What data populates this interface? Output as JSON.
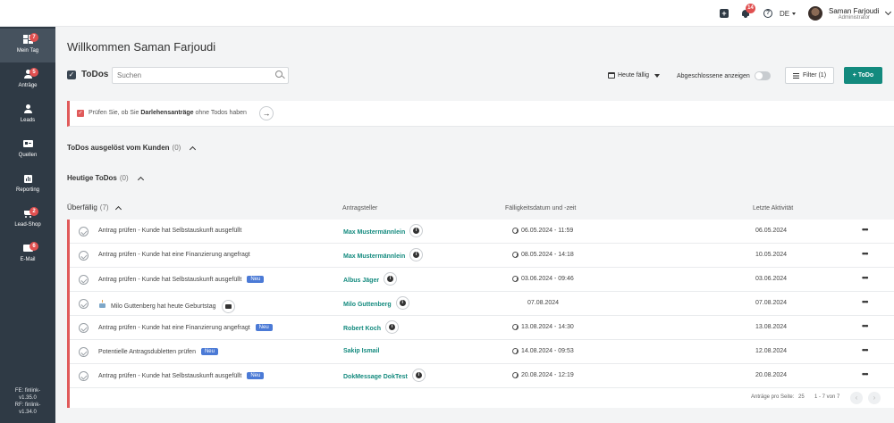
{
  "topbar": {
    "plus_icon": "plus-square-icon",
    "notifications_count": "14",
    "help_symbol": "?",
    "language": "DE",
    "user_name": "Saman Farjoudi",
    "user_role": "Administrator"
  },
  "sidebar": {
    "items": [
      {
        "label": "Mein Tag",
        "badge": "7",
        "icon": "dashboard-icon"
      },
      {
        "label": "Anträge",
        "badge": "5",
        "icon": "users-icon"
      },
      {
        "label": "Leads",
        "badge": "",
        "icon": "person-icon"
      },
      {
        "label": "Quellen",
        "badge": "",
        "icon": "id-card-icon"
      },
      {
        "label": "Reporting",
        "badge": "",
        "icon": "chart-icon"
      },
      {
        "label": "Lead-Shop",
        "badge": "2",
        "icon": "cart-icon"
      },
      {
        "label": "E-Mail",
        "badge": "6",
        "icon": "mail-icon"
      }
    ],
    "version_fe": "FE: finlink-",
    "version_fe_num": "v1.35.0",
    "version_rf": "RF: finlink-",
    "version_rf_num": "v1.34.0"
  },
  "main": {
    "title": "Willkommen Saman Farjoudi",
    "todos_title": "ToDos",
    "search_placeholder": "Suchen",
    "due_filter": "Heute fällig",
    "show_completed": "Abgeschlossene anzeigen",
    "filter_label": "Filter (1)",
    "add_todo": "+ ToDo",
    "banner": {
      "text_before": "Prüfen Sie, ob Sie ",
      "text_bold": "Darlehensanträge",
      "text_after": " ohne Todos haben",
      "arrow": "→"
    },
    "sections": [
      {
        "label": "ToDos ausgelöst vom Kunden",
        "count": "(0)"
      },
      {
        "label": "Heutige ToDos",
        "count": "(0)"
      },
      {
        "label": "Überfällig",
        "count": "(7)"
      }
    ],
    "columns": {
      "applicant": "Antragsteller",
      "due": "Fälligkeitsdatum und -zeit",
      "last_activity": "Letzte Aktivität"
    },
    "rows": [
      {
        "title": "Antrag prüfen - Kunde hat Selbstauskunft ausgefüllt",
        "tag": "",
        "applicant": "Max Mustermännlein",
        "due": "06.05.2024 - 11:59",
        "last": "06.05.2024",
        "more": "•••"
      },
      {
        "title": "Antrag prüfen - Kunde hat eine Finanzierung angefragt",
        "tag": "",
        "applicant": "Max Mustermännlein",
        "due": "08.05.2024 - 14:18",
        "last": "10.05.2024",
        "more": "•••"
      },
      {
        "title": "Antrag prüfen - Kunde hat Selbstauskunft ausgefüllt",
        "tag": "Neu",
        "applicant": "Albus Jäger",
        "due": "03.06.2024 - 09:46",
        "last": "03.06.2024",
        "more": "•••"
      },
      {
        "title": "Milo Guttenberg hat heute Geburtstag",
        "tag": "",
        "applicant": "Milo Guttenberg",
        "due": "07.08.2024",
        "last": "07.08.2024",
        "more": "•••"
      },
      {
        "title": "Antrag prüfen - Kunde hat eine Finanzierung angefragt",
        "tag": "Neu",
        "applicant": "Robert Koch",
        "due": "13.08.2024 - 14:30",
        "last": "13.08.2024",
        "more": "•••"
      },
      {
        "title": "Potentielle Antragsdubletten prüfen",
        "tag": "Neu",
        "applicant": "Sakip Ismail",
        "due": "14.08.2024 - 09:53",
        "last": "12.08.2024",
        "more": "•••"
      },
      {
        "title": "Antrag prüfen - Kunde hat Selbstauskunft ausgefüllt",
        "tag": "Neu",
        "applicant": "DokMessage DokTest",
        "due": "20.08.2024 - 12:19",
        "last": "20.08.2024",
        "more": "•••"
      }
    ],
    "footer": {
      "per_page_label": "Anträge pro Seite:",
      "per_page_value": "25",
      "range": "1 - 7 von 7",
      "prev": "‹",
      "next": "›"
    }
  }
}
